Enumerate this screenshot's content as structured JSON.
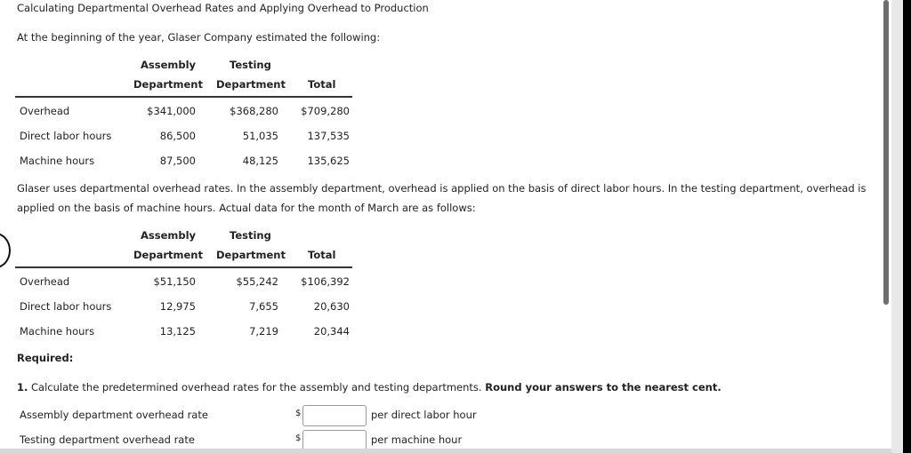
{
  "title": "Calculating Departmental Overhead Rates and Applying Overhead to Production",
  "intro": "At the beginning of the year, Glaser Company estimated the following:",
  "table1": {
    "headers": {
      "assembly1": "Assembly",
      "assembly2": "Department",
      "testing1": "Testing",
      "testing2": "Department",
      "total": "Total"
    },
    "rows": [
      {
        "label": "Overhead",
        "assembly": "$341,000",
        "testing": "$368,280",
        "total": "$709,280"
      },
      {
        "label": "Direct labor hours",
        "assembly": "86,500",
        "testing": "51,035",
        "total": "137,535"
      },
      {
        "label": "Machine hours",
        "assembly": "87,500",
        "testing": "48,125",
        "total": "135,625"
      }
    ]
  },
  "para1": "Glaser uses departmental overhead rates. In the assembly department, overhead is applied on the basis of direct labor hours. In the testing department, overhead is",
  "para2": "applied on the basis of machine hours. Actual data for the month of March are as follows:",
  "table2": {
    "headers": {
      "assembly1": "Assembly",
      "assembly2": "Department",
      "testing1": "Testing",
      "testing2": "Department",
      "total": "Total"
    },
    "rows": [
      {
        "label": "Overhead",
        "assembly": "$51,150",
        "testing": "$55,242",
        "total": "$106,392"
      },
      {
        "label": "Direct labor hours",
        "assembly": "12,975",
        "testing": "7,655",
        "total": "20,630"
      },
      {
        "label": "Machine hours",
        "assembly": "13,125",
        "testing": "7,219",
        "total": "20,344"
      }
    ]
  },
  "required": "Required:",
  "q1": {
    "num": "1.",
    "text": "Calculate the predetermined overhead rates for the assembly and testing departments.",
    "bold": "Round your answers to the nearest cent."
  },
  "answers": [
    {
      "label": "Assembly department overhead rate",
      "currency": "$",
      "value": "",
      "unit": "per direct labor hour"
    },
    {
      "label": "Testing department overhead rate",
      "currency": "$",
      "value": "",
      "unit": "per machine hour"
    }
  ]
}
